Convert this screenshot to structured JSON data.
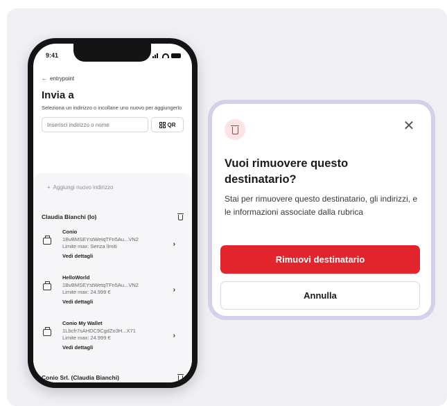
{
  "phone": {
    "status_time": "9:41",
    "back_label": "entrypoint",
    "title": "Invia a",
    "subtitle": "Seleziona un indirizzo o incollane uno nuovo per aggiungerlo",
    "search_placeholder": "Inserisci indirizzo o nome",
    "qr_label": "QR",
    "add_address_label": "Aggiungi nuovo indirizzo",
    "groups": [
      {
        "title": "Claudia Bianchi (Io)",
        "entries": [
          {
            "name": "Conio",
            "address": "1BvBMSEYstWetqTFn5Au...VN2",
            "limit": "Limite max: Senza limiti",
            "details": "Vedi dettagli"
          },
          {
            "name": "HelloWorld",
            "address": "1BvBMSEYstWetqTFn5Au...VN2",
            "limit": "Limite max: 24.999 €",
            "details": "Vedi dettagli"
          },
          {
            "name": "Conio My Wallet",
            "address": "1Lbcfr7sAHDC9CgdZo3H...X71",
            "limit": "Limite max: 24.999 €",
            "details": "Vedi dettagli"
          }
        ]
      },
      {
        "title": "Conio Srl. (Claudia Bianchi)"
      }
    ]
  },
  "dialog": {
    "title": "Vuoi rimuovere questo destinatario?",
    "body": "Stai per rimuovere questo destinatario, gli indirizzi, e le informazioni associate dalla rubrica",
    "confirm_label": "Rimuovi destinatario",
    "cancel_label": "Annulla",
    "accent_color": "#e2252c"
  }
}
